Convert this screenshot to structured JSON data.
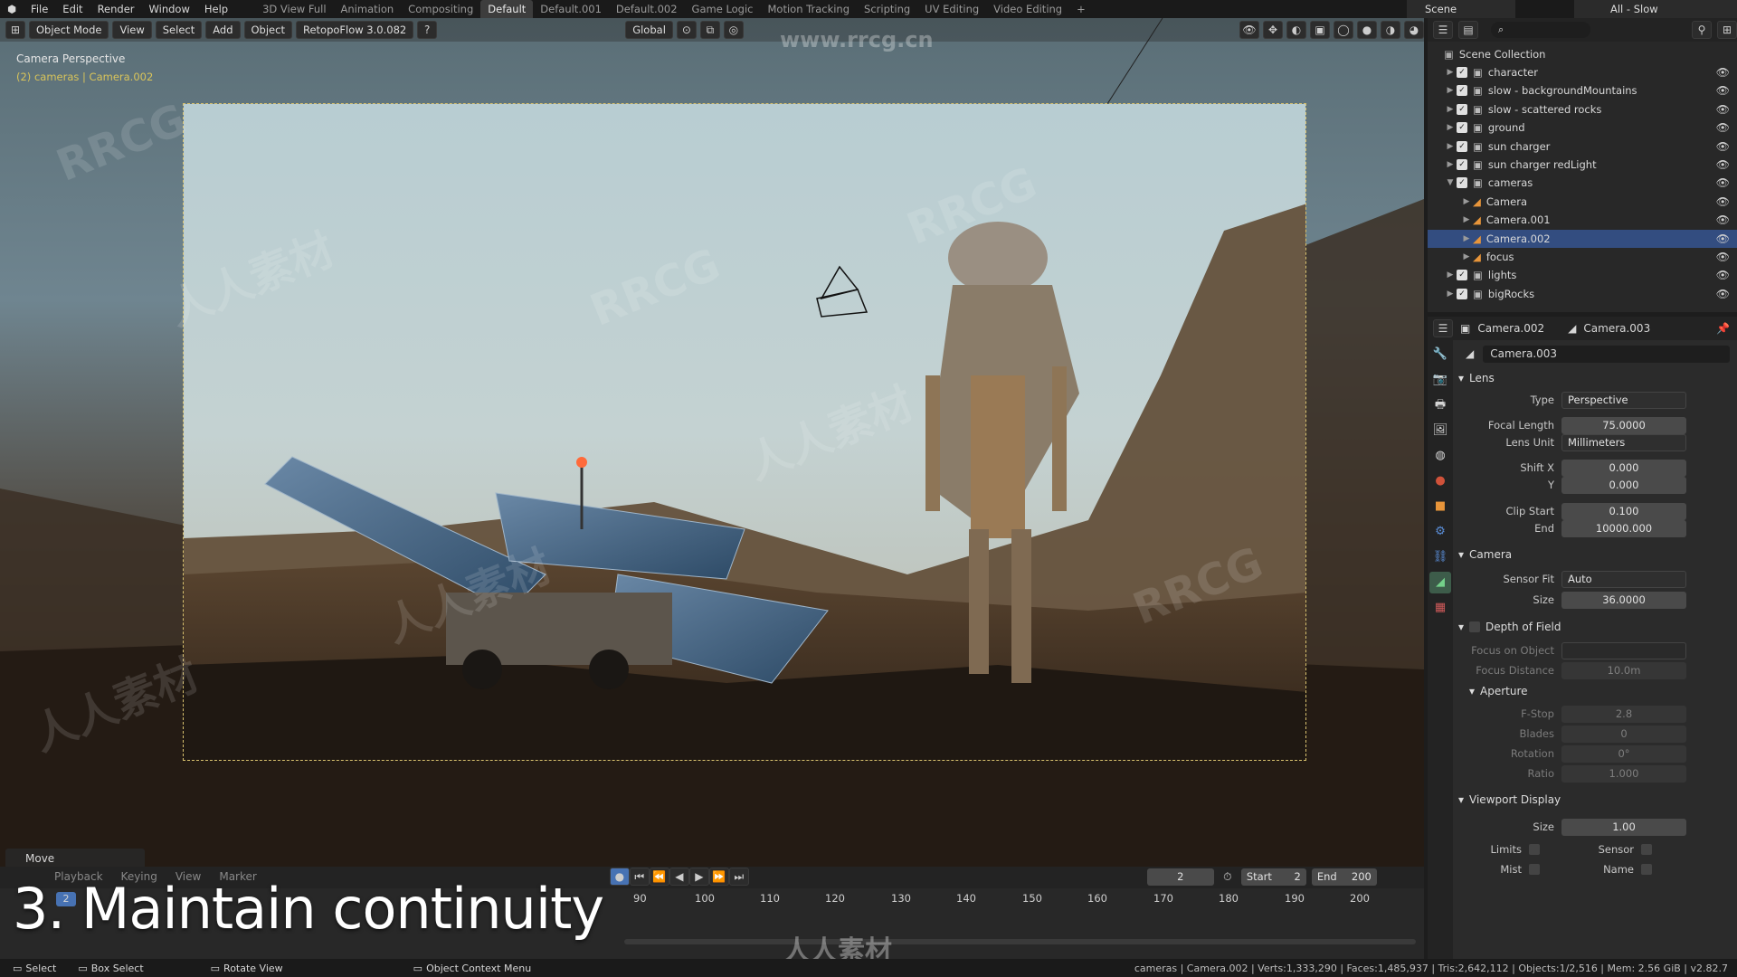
{
  "menu": [
    "File",
    "Edit",
    "Render",
    "Window",
    "Help"
  ],
  "workspaces": [
    "3D View Full",
    "Animation",
    "Compositing",
    "Default",
    "Default.001",
    "Default.002",
    "Game Logic",
    "Motion Tracking",
    "Scripting",
    "UV Editing",
    "Video Editing"
  ],
  "active_workspace": "Default",
  "scene_name": "Scene",
  "view_layer": "All - Slow",
  "viewport": {
    "mode": "Object Mode",
    "menus": [
      "View",
      "Select",
      "Add",
      "Object"
    ],
    "addon": "RetopoFlow 3.0.082",
    "transform_orientation": "Global",
    "camera_label": "Camera Perspective",
    "camera_sub": "(2) cameras | Camera.002",
    "last_op": "Move"
  },
  "watermark": {
    "rrcg": "RRCG",
    "cn": "人人素材",
    "url": "www.rrcg.cn"
  },
  "overlay_title": "3. Maintain continuity",
  "timeline": {
    "menus": [
      "Playback",
      "Keying",
      "View",
      "Marker"
    ],
    "current_frame": "2",
    "start_label": "Start",
    "start": "2",
    "end_label": "End",
    "end": "200",
    "ticks": [
      "90",
      "100",
      "110",
      "120",
      "130",
      "140",
      "150",
      "160",
      "170",
      "180",
      "190",
      "200"
    ],
    "frame_badge": "2"
  },
  "status": {
    "items": [
      "Select",
      "Box Select",
      "Rotate View",
      "Object Context Menu"
    ],
    "info": "cameras | Camera.002 | Verts:1,333,290 | Faces:1,485,937 | Tris:2,642,112 | Objects:1/2,516 | Mem: 2.56 GiB | v2.82.7"
  },
  "outliner": {
    "root": "Scene Collection",
    "items": [
      {
        "label": "character",
        "depth": 0,
        "expanded": false,
        "selected": false
      },
      {
        "label": "slow - backgroundMountains",
        "depth": 0,
        "expanded": false,
        "selected": false
      },
      {
        "label": "slow - scattered rocks",
        "depth": 0,
        "expanded": false,
        "selected": false
      },
      {
        "label": "ground",
        "depth": 0,
        "expanded": false,
        "selected": false
      },
      {
        "label": "sun charger",
        "depth": 0,
        "expanded": false,
        "selected": false
      },
      {
        "label": "sun charger redLight",
        "depth": 0,
        "expanded": false,
        "selected": false
      },
      {
        "label": "cameras",
        "depth": 0,
        "expanded": true,
        "selected": false
      },
      {
        "label": "Camera",
        "depth": 1,
        "expanded": false,
        "selected": false
      },
      {
        "label": "Camera.001",
        "depth": 1,
        "expanded": false,
        "selected": false
      },
      {
        "label": "Camera.002",
        "depth": 1,
        "expanded": false,
        "selected": true
      },
      {
        "label": "focus",
        "depth": 1,
        "expanded": false,
        "selected": false
      },
      {
        "label": "lights",
        "depth": 0,
        "expanded": false,
        "selected": false
      },
      {
        "label": "bigRocks",
        "depth": 0,
        "expanded": false,
        "selected": false
      }
    ]
  },
  "properties": {
    "breadcrumb_object": "Camera.002",
    "breadcrumb_data": "Camera.003",
    "datablock": "Camera.003",
    "lens": {
      "title": "Lens",
      "type_label": "Type",
      "type": "Perspective",
      "focal_label": "Focal Length",
      "focal": "75.0000",
      "unit_label": "Lens Unit",
      "unit": "Millimeters",
      "shiftx_label": "Shift X",
      "shiftx": "0.000",
      "shifty_label": "Y",
      "shifty": "0.000",
      "clipstart_label": "Clip Start",
      "clipstart": "0.100",
      "clipend_label": "End",
      "clipend": "10000.000"
    },
    "camera": {
      "title": "Camera",
      "fit_label": "Sensor Fit",
      "fit": "Auto",
      "size_label": "Size",
      "size": "36.0000"
    },
    "dof": {
      "title": "Depth of Field",
      "focus_obj_label": "Focus on Object",
      "focus_dist_label": "Focus Distance",
      "focus_dist": "10.0m",
      "aperture_title": "Aperture",
      "fstop_label": "F-Stop",
      "fstop": "2.8",
      "blades_label": "Blades",
      "blades": "0",
      "rotation_label": "Rotation",
      "rotation": "0°",
      "ratio_label": "Ratio",
      "ratio": "1.000"
    },
    "display": {
      "title": "Viewport Display",
      "size_label": "Size",
      "size": "1.00",
      "limits_label": "Limits",
      "sensor_label": "Sensor",
      "mist_label": "Mist",
      "name_label": "Name"
    }
  }
}
